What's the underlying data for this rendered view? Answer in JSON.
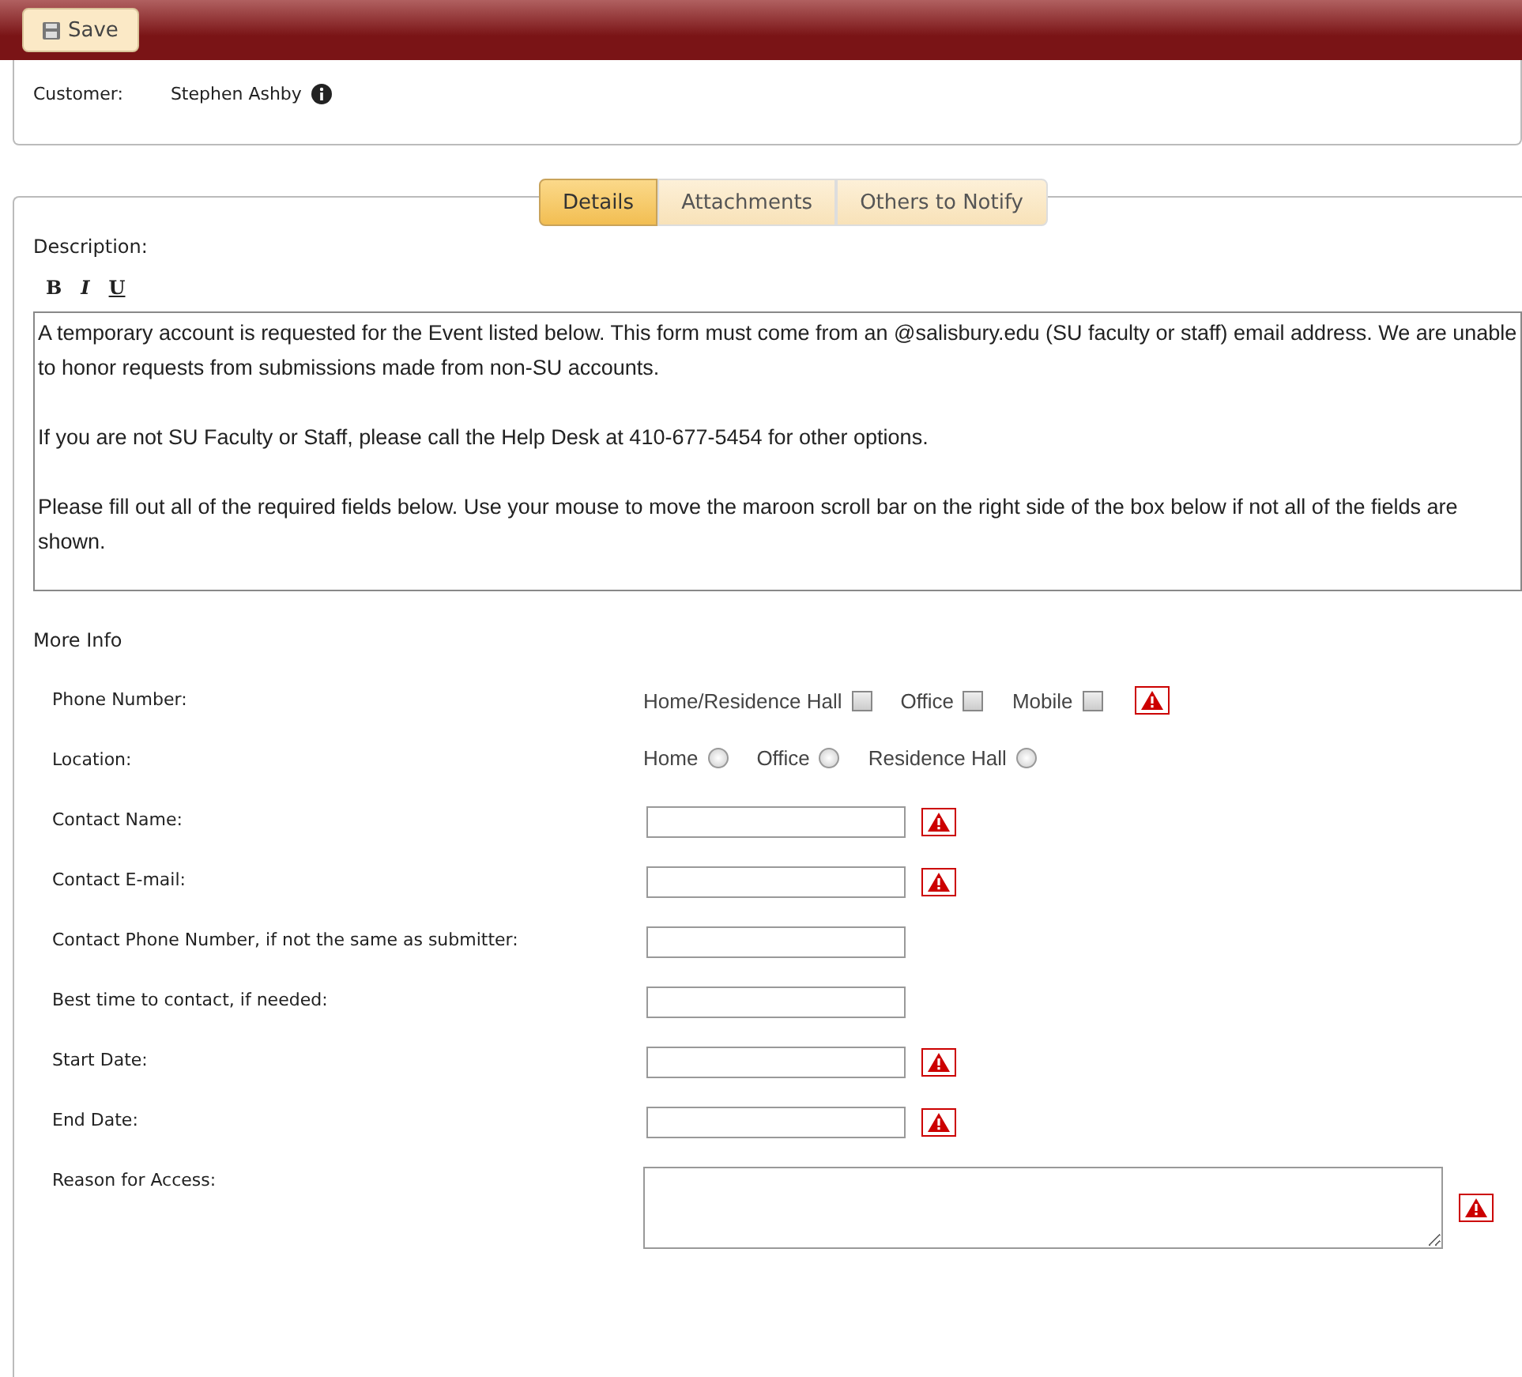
{
  "toolbar": {
    "save_button": "Save"
  },
  "customer": {
    "label": "Customer:",
    "name": "Stephen Ashby"
  },
  "tabs": [
    {
      "label": "Details",
      "selected": true
    },
    {
      "label": "Attachments",
      "selected": false
    },
    {
      "label": "Others to Notify",
      "selected": false
    }
  ],
  "description": {
    "label": "Description:",
    "format_buttons": [
      "B",
      "I",
      "U"
    ],
    "paragraphs": [
      "A temporary account is requested for the Event listed below. This form must come from an @salisbury.edu (SU faculty or staff) email address. We are unable to honor requests from submissions made from non-SU accounts.",
      "If you are not SU Faculty or Staff, please call the Help Desk at 410-677-5454 for other options.",
      "Please fill out all of the required fields below. Use your mouse to move the maroon scroll bar on the right side of the box below if not all of the fields are shown."
    ]
  },
  "more_info": {
    "title": "More Info",
    "fields": [
      {
        "label": "Phone Number:",
        "kind": "checkboxes",
        "required": true,
        "options": [
          {
            "label": "Home/Residence Hall",
            "checked": false
          },
          {
            "label": "Office",
            "checked": false
          },
          {
            "label": "Mobile",
            "checked": false
          }
        ]
      },
      {
        "label": "Location:",
        "kind": "radios",
        "required": false,
        "options": [
          {
            "label": "Home",
            "selected": false
          },
          {
            "label": "Office",
            "selected": false
          },
          {
            "label": "Residence Hall",
            "selected": false
          }
        ]
      },
      {
        "label": "Contact Name:",
        "kind": "text",
        "required": true
      },
      {
        "label": "Contact E-mail:",
        "kind": "text",
        "required": true
      },
      {
        "label": "Contact Phone Number, if not the same as submitter:",
        "kind": "text",
        "required": false
      },
      {
        "label": "Best time to contact, if needed:",
        "kind": "text",
        "required": false
      },
      {
        "label": "Start Date:",
        "kind": "text",
        "required": true
      },
      {
        "label": "End Date:",
        "kind": "text",
        "required": true
      },
      {
        "label": "Reason for Access:",
        "kind": "textarea",
        "required": true
      }
    ]
  }
}
